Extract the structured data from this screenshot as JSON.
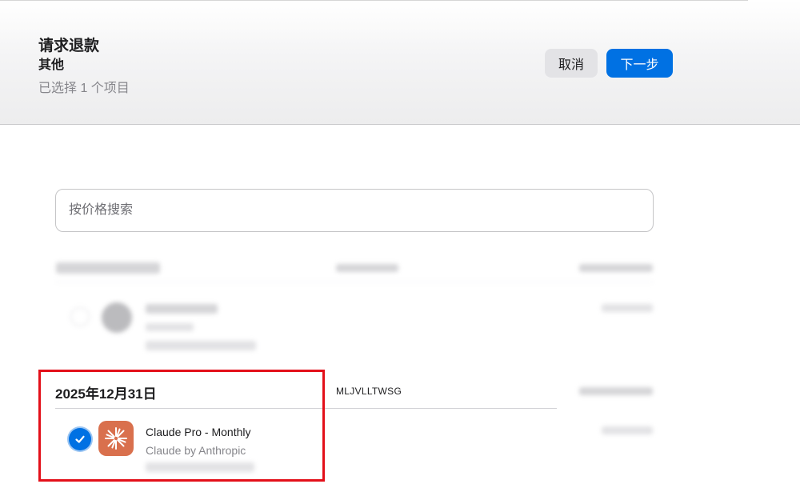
{
  "header": {
    "title": "请求退款",
    "reason": "其他",
    "selection_count": "已选择 1 个项目",
    "cancel_label": "取消",
    "next_label": "下一步"
  },
  "search": {
    "placeholder": "按价格搜索",
    "value": ""
  },
  "purchases": [
    {
      "date": "2025年12月31日",
      "order_id": "MLJVLLTWSG",
      "items": [
        {
          "name": "Claude Pro - Monthly",
          "developer": "Claude by Anthropic",
          "selected": true,
          "icon": "claude-sparkle-icon"
        }
      ]
    }
  ],
  "colors": {
    "accent": "#0071e3",
    "app_icon_bg": "#d9704d",
    "highlight": "#e3101a"
  }
}
